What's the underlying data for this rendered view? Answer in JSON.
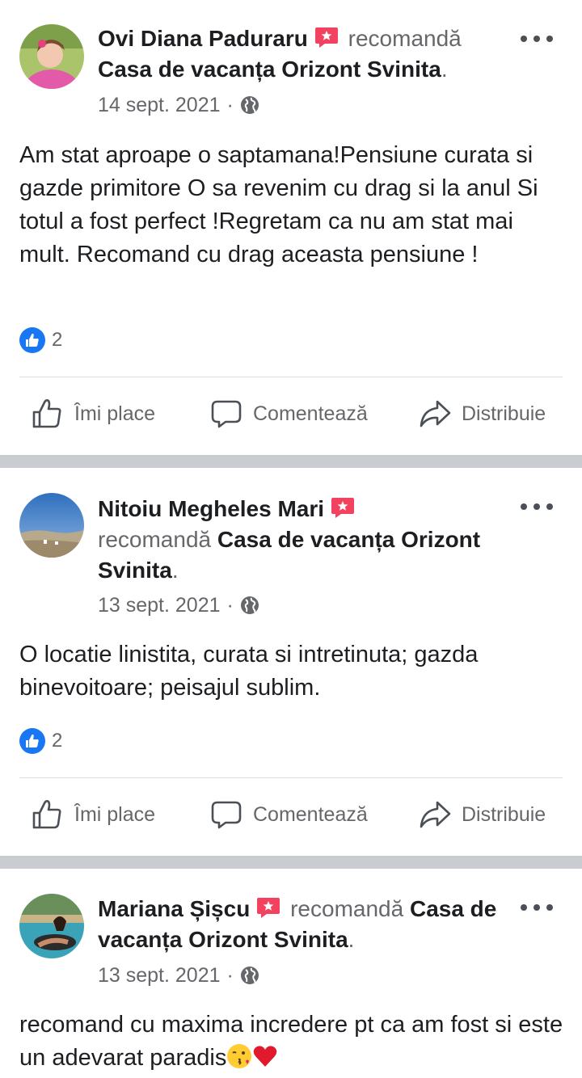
{
  "posts": [
    {
      "author": "Ovi Diana Paduraru",
      "verb": "recomandă",
      "page": "Casa de vacanța Orizont Svinita",
      "punct": ".",
      "date": "14 sept. 2021",
      "date_sep": "·",
      "body": "Am stat aproape o saptamana!Pensiune curata si gazde primitore O sa revenim cu drag si la anul Si totul a fost perfect !Regretam ca nu am stat mai mult. Recomand cu drag aceasta pensiune !",
      "likes": "2",
      "actions": {
        "like": "Îmi place",
        "comment": "Comentează",
        "share": "Distribuie"
      }
    },
    {
      "author": "Nitoiu Megheles Mari",
      "verb": "recomandă",
      "page": "Casa de vacanța Orizont Svinita",
      "punct": ".",
      "date": "13 sept. 2021",
      "date_sep": "·",
      "body": "O locatie linistita, curata si intretinuta; gazda binevoitoare; peisajul sublim.",
      "likes": "2",
      "actions": {
        "like": "Îmi place",
        "comment": "Comentează",
        "share": "Distribuie"
      }
    },
    {
      "author": "Mariana Șișcu",
      "verb": "recomandă",
      "page": "Casa de vacanța Orizont Svinita",
      "punct": ".",
      "date": "13 sept. 2021",
      "date_sep": "·",
      "body": "recomand cu maxima incredere pt ca am fost si este un adevarat paradis"
    }
  ],
  "icons": {
    "recommend_badge": "recommend-badge-icon",
    "globe": "globe-icon",
    "like": "thumbs-up-icon",
    "comment": "comment-bubble-icon",
    "share": "share-arrow-icon",
    "more": "more-dots-icon",
    "kiss_emoji": "face-blowing-kiss-emoji",
    "heart_emoji": "red-heart-emoji"
  },
  "colors": {
    "accent": "#1877f2",
    "badge": "#f3425f",
    "secondary_text": "#65676b",
    "separator": "#c9ccd1"
  }
}
